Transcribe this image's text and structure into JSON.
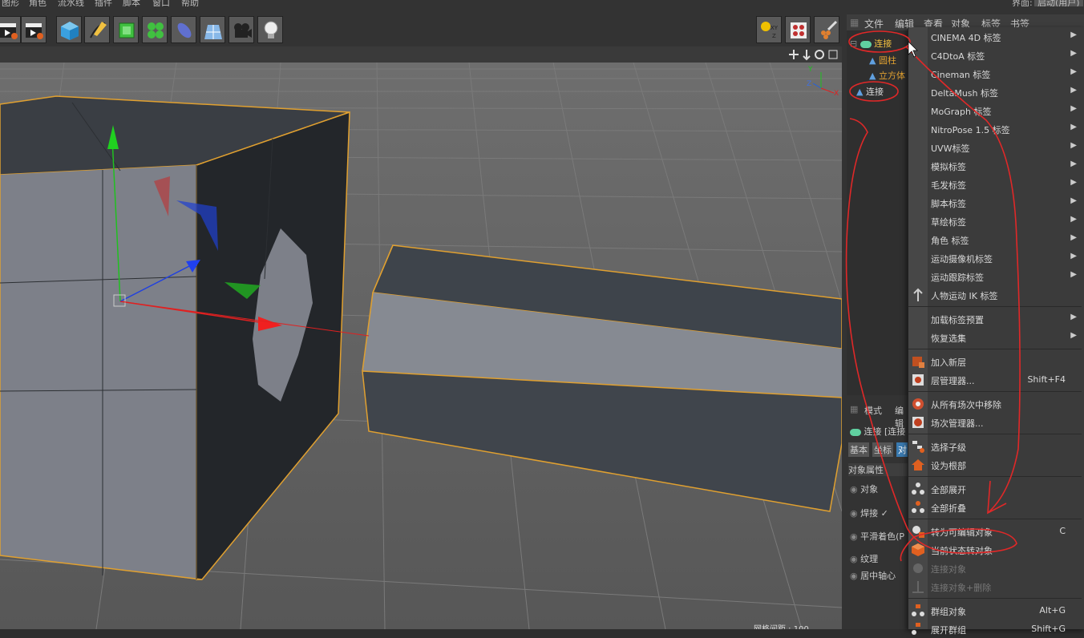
{
  "menubar": {
    "items": [
      "图形",
      "角色",
      "流水线",
      "插件",
      "脚本",
      "窗口",
      "帮助"
    ],
    "right_label": "界面:",
    "right_value": "启动(用户)"
  },
  "object_manager": {
    "tabs": [
      "文件",
      "编辑",
      "查看",
      "对象",
      "标签",
      "书签"
    ],
    "objects": [
      "连接",
      "圆柱",
      "立方体",
      "连接"
    ]
  },
  "attributes": {
    "tabs": [
      "模式",
      "编辑"
    ],
    "title": "连接 [连接",
    "subtabs": [
      "基本",
      "坐标",
      "对"
    ],
    "section": "对象属性",
    "rows": [
      "对象",
      "焊接",
      "平滑着色(P",
      "纹理",
      "居中轴心"
    ]
  },
  "viewport_status": "网格间距 : 100",
  "axis_labels": {
    "y": "Y",
    "z": "Z",
    "x": "X"
  },
  "context_menu": {
    "submenus": [
      "CINEMA 4D 标签",
      "C4DtoA 标签",
      "Cineman 标签",
      "DeltaMush 标签",
      "MoGraph 标签",
      "NitroPose 1.5 标签",
      "UVW标签",
      "模拟标签",
      "毛发标签",
      "脚本标签",
      "草绘标签",
      "角色 标签",
      "运动摄像机标签",
      "运动跟踪标签"
    ],
    "ik_tag": "人物运动 IK 标签",
    "presets": [
      "加载标签预置",
      "恢复选集"
    ],
    "layer": [
      {
        "label": "加入新层",
        "shortcut": ""
      },
      {
        "label": "层管理器...",
        "shortcut": "Shift+F4"
      }
    ],
    "take": [
      {
        "label": "从所有场次中移除",
        "shortcut": ""
      },
      {
        "label": "场次管理器...",
        "shortcut": ""
      }
    ],
    "hierarchy": [
      "选择子级",
      "设为根部"
    ],
    "fold": [
      "全部展开",
      "全部折叠"
    ],
    "convert": [
      {
        "label": "转为可编辑对象",
        "shortcut": "C",
        "disabled": false
      },
      {
        "label": "当前状态转对象",
        "shortcut": "",
        "disabled": false
      },
      {
        "label": "连接对象",
        "shortcut": "",
        "disabled": true
      },
      {
        "label": "连接对象+删除",
        "shortcut": "",
        "disabled": true
      }
    ],
    "group": [
      {
        "label": "群组对象",
        "shortcut": "Alt+G"
      },
      {
        "label": "展开群组",
        "shortcut": "Shift+G"
      }
    ],
    "arrow": "▶"
  },
  "colors": {
    "accent_orange": "#e0a030",
    "annotation_red": "#e03030",
    "selection_highlight": "#f0c040"
  }
}
